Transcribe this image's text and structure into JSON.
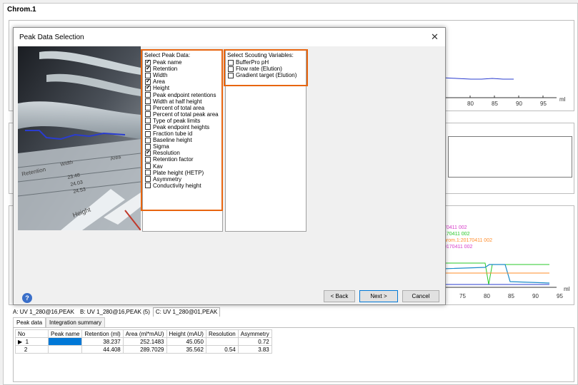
{
  "window": {
    "title": "Chrom.1"
  },
  "chart_top": {
    "x_ticks": [
      "80",
      "85",
      "90",
      "95"
    ],
    "unit": "ml"
  },
  "chart_mid": {
    "x_ticks": [
      "75",
      "80",
      "85",
      "90",
      "95"
    ],
    "unit": "ml",
    "legend": [
      "70411 002",
      "170411 002",
      "hrom.1:20170411 002",
      "0170411 002"
    ],
    "legend_colors": [
      "#d63cc9",
      "#28c828",
      "#ff8c2a",
      "#d63cc9"
    ]
  },
  "dialog": {
    "title": "Peak Data Selection",
    "close_glyph": "✕",
    "help_glyph": "?",
    "peak_data_header": "Select Peak Data:",
    "peak_data": [
      {
        "label": "Peak name",
        "checked": true
      },
      {
        "label": "Retention",
        "checked": true
      },
      {
        "label": "Width",
        "checked": false
      },
      {
        "label": "Area",
        "checked": true
      },
      {
        "label": "Height",
        "checked": true
      },
      {
        "label": "Peak endpoint retentions",
        "checked": false
      },
      {
        "label": "Width at half height",
        "checked": false
      },
      {
        "label": "Percent of total area",
        "checked": false
      },
      {
        "label": "Percent of total peak area",
        "checked": false
      },
      {
        "label": "Type of peak limits",
        "checked": false
      },
      {
        "label": "Peak endpoint heights",
        "checked": false
      },
      {
        "label": "Fraction tube id",
        "checked": false
      },
      {
        "label": "Baseline height",
        "checked": false
      },
      {
        "label": "Sigma",
        "checked": false
      },
      {
        "label": "Resolution",
        "checked": true
      },
      {
        "label": "Retention factor",
        "checked": false
      },
      {
        "label": "Kav",
        "checked": false
      },
      {
        "label": "Plate height (HETP)",
        "checked": false
      },
      {
        "label": "Asymmetry",
        "checked": false
      },
      {
        "label": "Conductivity height",
        "checked": false
      }
    ],
    "scouting_header": "Select Scouting Variables:",
    "scouting": [
      {
        "label": "BufferPro pH",
        "checked": false
      },
      {
        "label": "Flow rate (Elution)",
        "checked": false
      },
      {
        "label": "Gradient target (Elution)",
        "checked": false
      }
    ],
    "buttons": {
      "back": "< Back",
      "next": "Next >",
      "cancel": "Cancel"
    },
    "image_texts": [
      "Retention",
      "Height",
      "Width",
      "Area",
      "23.48",
      "24.03",
      "24.53"
    ]
  },
  "chrom_tabs": [
    "A: UV 1_280@16,PEAK",
    "B: UV 1_280@16,PEAK (5)",
    "C: UV 1_280@01,PEAK"
  ],
  "sub_tabs": [
    "Peak data",
    "Integration summary"
  ],
  "table": {
    "headers": [
      "No",
      "Peak name",
      "Retention (ml)",
      "Area (ml*mAU)",
      "Height (mAU)",
      "Resolution",
      "Asymmetry"
    ],
    "rows": [
      {
        "marker": "▶",
        "no": "1",
        "name": "",
        "retention": "38.237",
        "area": "252.1483",
        "height": "45.050",
        "resolution": "",
        "asymmetry": "0.72"
      },
      {
        "marker": "",
        "no": "2",
        "name": "",
        "retention": "44.408",
        "area": "289.7029",
        "height": "35.562",
        "resolution": "0.54",
        "asymmetry": "3.83"
      }
    ]
  },
  "colors": {
    "accent_highlight": "#e8650f",
    "selection": "#0078d7"
  }
}
